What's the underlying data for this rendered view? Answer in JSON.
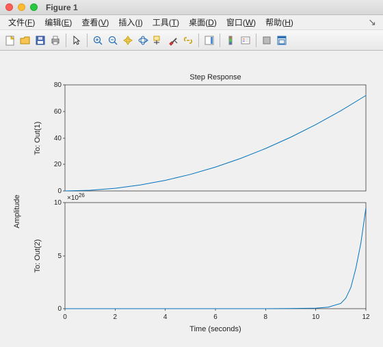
{
  "window": {
    "title": "Figure 1"
  },
  "menu": {
    "items": [
      {
        "label": "文件",
        "key": "F"
      },
      {
        "label": "编辑",
        "key": "E"
      },
      {
        "label": "查看",
        "key": "V"
      },
      {
        "label": "插入",
        "key": "I"
      },
      {
        "label": "工具",
        "key": "T"
      },
      {
        "label": "桌面",
        "key": "D"
      },
      {
        "label": "窗口",
        "key": "W"
      },
      {
        "label": "帮助",
        "key": "H"
      }
    ]
  },
  "toolbar": {
    "icons": [
      "new-figure-icon",
      "open-icon",
      "save-icon",
      "print-icon",
      "sep",
      "pointer-icon",
      "sep",
      "zoom-in-icon",
      "zoom-out-icon",
      "pan-icon",
      "rotate3d-icon",
      "datacursor-icon",
      "brush-icon",
      "colorbar-icon",
      "sep",
      "link-icon",
      "sep",
      "insert-colorbar-icon",
      "legend-icon",
      "sep",
      "hide-icon",
      "dock-icon"
    ]
  },
  "chart_data": [
    {
      "type": "line",
      "title": "Step Response",
      "xlabel": "Time (seconds)",
      "ylabel_left": "To: Out(1)",
      "xlim": [
        0,
        12
      ],
      "ylim": [
        0,
        80
      ],
      "yticks": [
        0,
        20,
        40,
        60,
        80
      ],
      "x": [
        0,
        1,
        2,
        3,
        4,
        5,
        6,
        7,
        8,
        9,
        10,
        11,
        12
      ],
      "y": [
        0,
        0.5,
        2,
        4.5,
        8,
        12.5,
        18,
        24.5,
        32,
        40.5,
        50,
        60.5,
        72
      ]
    },
    {
      "type": "line",
      "ylabel_left": "To: Out(2)",
      "y_exponent_label": "×10^26",
      "xlim": [
        0,
        12
      ],
      "ylim": [
        0,
        10
      ],
      "yticks": [
        0,
        5,
        10
      ],
      "xticks": [
        0,
        2,
        4,
        6,
        8,
        10,
        12
      ],
      "x": [
        0,
        2,
        4,
        6,
        8,
        9,
        10,
        10.5,
        11,
        11.2,
        11.4,
        11.6,
        11.8,
        12
      ],
      "y": [
        0,
        0,
        0,
        0,
        0,
        0.01,
        0.05,
        0.15,
        0.5,
        1.0,
        2.0,
        3.8,
        6.2,
        9.5
      ]
    }
  ],
  "labels": {
    "amplitude": "Amplitude",
    "xlabel": "Time (seconds)",
    "title": "Step Response",
    "exp": "×10",
    "exp_sup": "26",
    "out1": "To: Out(1)",
    "out2": "To: Out(2)"
  }
}
